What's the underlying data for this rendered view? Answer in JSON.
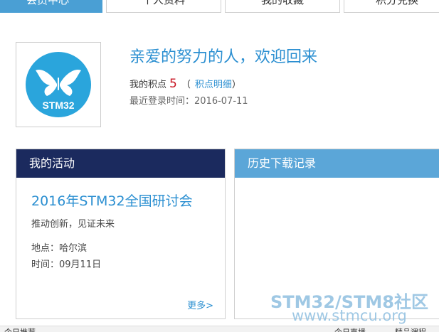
{
  "tabs": [
    {
      "label": "会员中心",
      "active": true
    },
    {
      "label": "个人资料",
      "active": false
    },
    {
      "label": "我的收藏",
      "active": false
    },
    {
      "label": "积分兑换",
      "active": false
    }
  ],
  "profile": {
    "avatar_logo": "STM32",
    "welcome": "亲爱的努力的人，欢迎回来",
    "points_label": "我的积点",
    "points_value": "5",
    "points_detail": "积点明细",
    "last_login": "最近登录时间：2016-07-11"
  },
  "activity": {
    "header": "我的活动",
    "event_title": "2016年STM32全国研讨会",
    "slogan": "推动创新，见证未来",
    "place": "地点：哈尔滨",
    "time": "时间：09月11日",
    "more": "更多>"
  },
  "history": {
    "header": "历史下载记录"
  },
  "watermark": {
    "line1": "STM32/STM8社区",
    "line2": "www.stmcu.org"
  },
  "bottom_bar": {
    "left": "今日推荐",
    "middle": "今日直播",
    "right": "精品课程"
  },
  "colors": {
    "accent_blue": "#2b8fd1",
    "activity_header": "#1b2a5e",
    "history_header": "#5ba6d8",
    "points_red": "#c81623"
  }
}
